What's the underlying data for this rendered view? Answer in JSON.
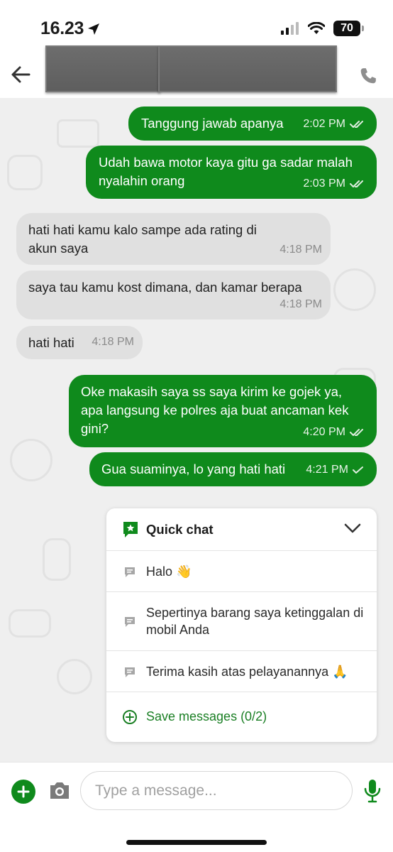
{
  "status": {
    "time": "16.23",
    "battery": "70"
  },
  "header": {
    "contact_name": ""
  },
  "messages": [
    {
      "dir": "out",
      "text": "Tanggung jawab apanya",
      "time": "2:02 PM",
      "read": true
    },
    {
      "dir": "out",
      "text": "Udah bawa motor kaya gitu ga sadar malah nyalahin orang",
      "time": "2:03 PM",
      "read": true
    },
    {
      "dir": "in",
      "text": "hati hati kamu kalo sampe ada rating di akun saya",
      "time": "4:18 PM"
    },
    {
      "dir": "in",
      "text": "saya tau kamu kost dimana, dan kamar berapa",
      "time": "4:18 PM"
    },
    {
      "dir": "in",
      "text": "hati hati",
      "time": "4:18 PM"
    },
    {
      "dir": "out",
      "text": "Oke makasih saya ss saya kirim ke gojek ya, apa langsung ke polres aja buat ancaman kek gini?",
      "time": "4:20 PM",
      "read": true
    },
    {
      "dir": "out",
      "text": "Gua suaminya, lo yang hati hati",
      "time": "4:21 PM",
      "read": false
    }
  ],
  "quick_chat": {
    "title": "Quick chat",
    "items": [
      "Halo 👋",
      "Sepertinya barang saya ketinggalan di mobil Anda",
      "Terima kasih atas pelayanannya 🙏"
    ],
    "save_label": "Save messages (0/2)"
  },
  "input": {
    "placeholder": "Type a message..."
  },
  "colors": {
    "accent": "#0f8a1c",
    "incoming": "#e0e0e0",
    "background": "#efefef"
  }
}
